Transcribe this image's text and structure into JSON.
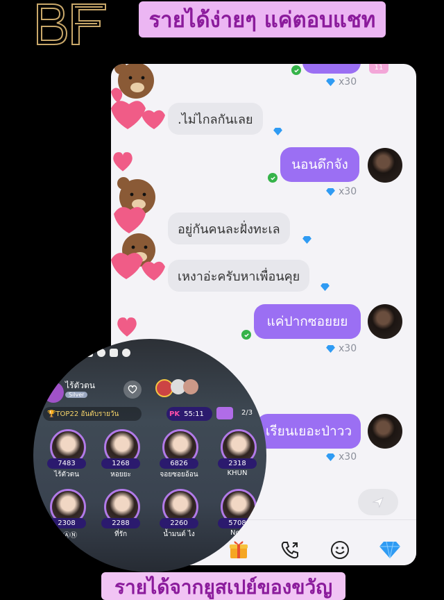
{
  "header": {
    "logo_text": "BF",
    "banner_top": "รายได้ง่ายๆ แค่ตอบแชท",
    "banner_bottom": "รายได้จากยูสเปย์ของขวัญ"
  },
  "chat": {
    "partial_badge": "11",
    "messages": [
      {
        "side": "right",
        "text": "",
        "reward": "x30"
      },
      {
        "side": "left",
        "text": ".ไม่ไกลกันเลย"
      },
      {
        "side": "right",
        "text": "นอนดึกจัง",
        "reward": "x30"
      },
      {
        "side": "left",
        "text": "อยู่กันคนละฝั่งทะเล"
      },
      {
        "side": "left",
        "text": "เหงาอ่ะครับหาเพื่อนคุย"
      },
      {
        "side": "right",
        "text": "แค่ปากซอยยย",
        "reward": "x30"
      },
      {
        "side": "right",
        "text": "เรียนเยอะป่าวว",
        "reward": "x30"
      }
    ]
  },
  "live": {
    "host_name": "ไร้ตัวตน",
    "host_badge": "Silver",
    "ranking": "TOP22 อันดับรายวัน",
    "pk_label": "PK",
    "pk_timer": "55:11",
    "page": "2/3",
    "tiles": [
      {
        "count": "7483",
        "name": "ไร้ตัวตน"
      },
      {
        "count": "1268",
        "name": "หอยยะ"
      },
      {
        "count": "6826",
        "name": "จอยซอยอ้อน"
      },
      {
        "count": "2318",
        "name": "KHUN"
      },
      {
        "count": "2308",
        "name": "ⓢⒶⓃ"
      },
      {
        "count": "2288",
        "name": "ที่รัก"
      },
      {
        "count": "2260",
        "name": "น้ำมนต์ ไง"
      },
      {
        "count": "5708",
        "name": "Non"
      }
    ]
  },
  "colors": {
    "accent": "#9b6ff3",
    "gem": "#2f9bf3",
    "banner_text": "#8b1b9c"
  }
}
